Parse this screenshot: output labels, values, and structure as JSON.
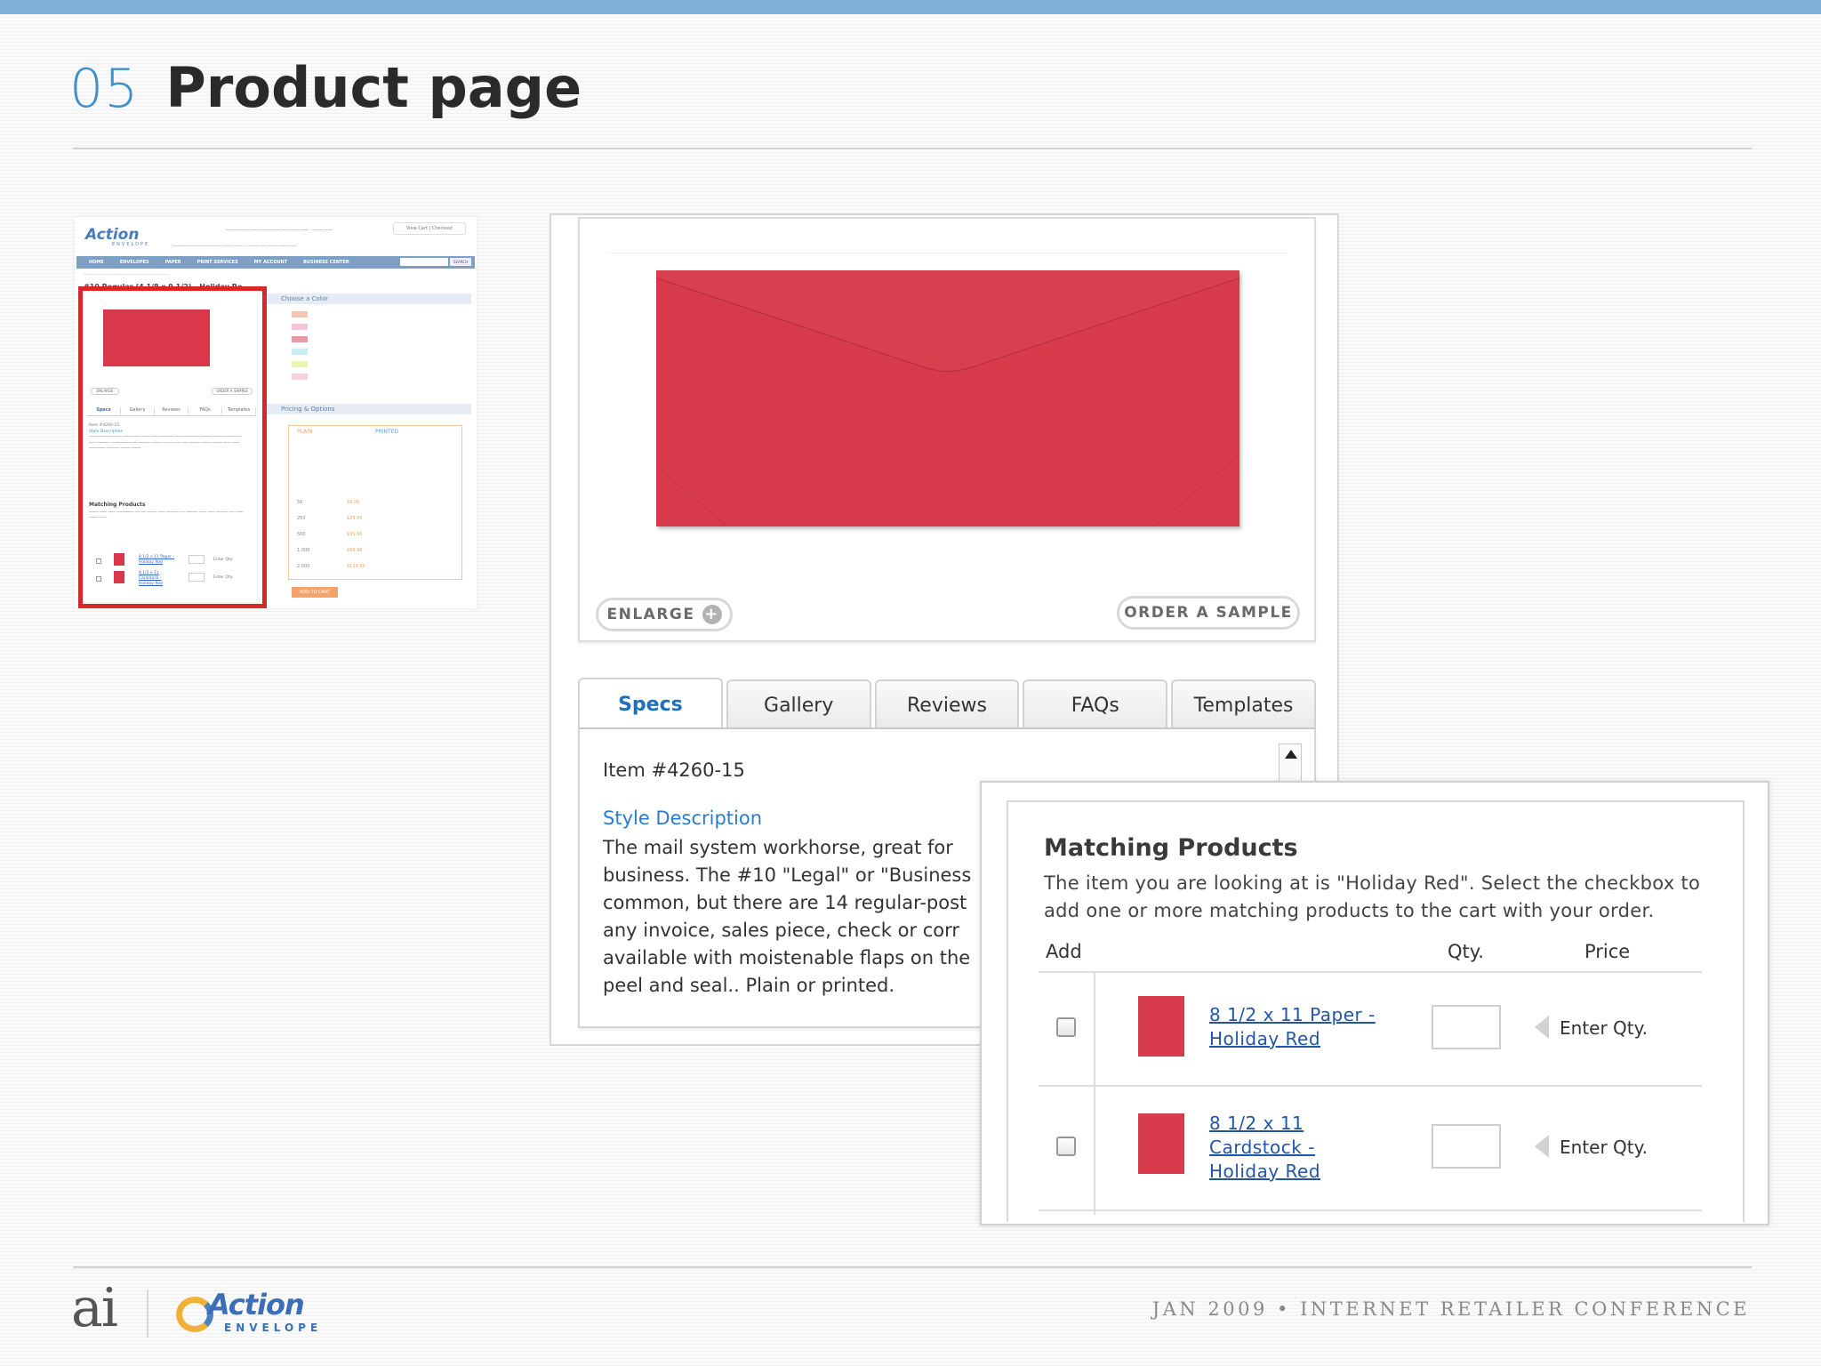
{
  "slide": {
    "number": "05",
    "title": "Product page",
    "footer_conference": "JAN 2009 • INTERNET RETAILER CONFERENCE",
    "footer_logo_ai": "ai",
    "footer_logo_action": "Action",
    "footer_logo_envelope": "ENVELOPE"
  },
  "thumbnail": {
    "logo": "Action",
    "logo_sub": "ENVELOPE",
    "nav": [
      "HOME",
      "ENVELOPES",
      "PAPER",
      "PRINT SERVICES",
      "MY ACCOUNT",
      "BUSINESS CENTER"
    ],
    "search_btn": "SEARCH",
    "view_cart": "View Cart | Checkout",
    "product_title": "#10 Regular (4 1/8 x 9 1/2) - Holiday Re",
    "enlarge": "ENLARGE",
    "order_sample": "ORDER A SAMPLE",
    "tabs": [
      "Specs",
      "Gallery",
      "Reviews",
      "FAQs",
      "Templates"
    ],
    "item": "Item #4260-15",
    "style_heading": "Style Description",
    "matching_title": "Matching Products",
    "step1": "Choose a Color",
    "step2": "Pricing & Options",
    "plain": "PLAIN",
    "printed": "PRINTED",
    "quantities": [
      "50",
      "250",
      "500",
      "1,000",
      "2,000"
    ],
    "prices": [
      "$9.95",
      "$25.95",
      "$39.95",
      "$69.95",
      "$119.95"
    ],
    "add_to_cart": "ADD TO CART",
    "product_links": [
      "8 1/2 x 11 Paper - Holiday Red",
      "8 1/2 x 11 Cardstock - Holiday Red"
    ],
    "enter_qty": "Enter Qty."
  },
  "product": {
    "enlarge_label": "ENLARGE",
    "order_sample_label": "ORDER A SAMPLE",
    "envelope_color": "#d63a4b",
    "tabs": [
      {
        "label": "Specs",
        "active": true
      },
      {
        "label": "Gallery",
        "active": false
      },
      {
        "label": "Reviews",
        "active": false
      },
      {
        "label": "FAQs",
        "active": false
      },
      {
        "label": "Templates",
        "active": false
      }
    ],
    "item_number": "Item #4260-15",
    "style_heading": "Style Description",
    "style_lines": [
      "The mail system workhorse, great for",
      "business. The #10 \"Legal\" or \"Business",
      "common, but there are 14 regular-post",
      "any invoice, sales piece, check or corr",
      "available with moistenable flaps on the",
      "peel and seal.. Plain or printed."
    ]
  },
  "matching": {
    "title": "Matching Products",
    "description": "The item you are looking at is \"Holiday Red\". Select the checkbox to add one or more matching products to the cart with your order.",
    "col_add": "Add",
    "col_qty": "Qty.",
    "col_price": "Price",
    "rows": [
      {
        "name": "8 1/2 x 11 Paper - Holiday Red",
        "line1": "8 1/2 x 11 Paper -",
        "line2": "Holiday Red",
        "line3": "",
        "price": "Enter Qty.",
        "qty": ""
      },
      {
        "name": "8 1/2 x 11 Cardstock - Holiday Red",
        "line1": "8 1/2 x 11",
        "line2": "Cardstock -",
        "line3": "Holiday Red",
        "price": "Enter Qty.",
        "qty": ""
      }
    ]
  }
}
